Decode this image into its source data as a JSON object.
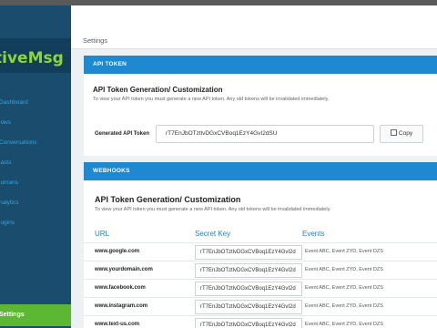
{
  "app": {
    "logo_text": "tiveMsg",
    "colors": {
      "sidebar": "#1a4c6e",
      "accent": "#1e88d0",
      "active": "#5cb832",
      "logo": "#8cd63a"
    }
  },
  "header": {
    "title": "Settings"
  },
  "sidebar": {
    "items": [
      {
        "label": "Dashboard"
      },
      {
        "label": "lows"
      },
      {
        "label": "Conversations"
      },
      {
        "label": "lasts"
      },
      {
        "label": "lumans"
      },
      {
        "label": "nalytics"
      },
      {
        "label": "lugins"
      }
    ],
    "active": {
      "label": "Settings"
    }
  },
  "api_token": {
    "section_title": "API TOKEN",
    "title": "API Token Generation/ Customization",
    "description": "To view your API token you must generate a new API token. Any old tokens will be invalidated immediately.",
    "field_label": "Generated API Token",
    "token_value": "rT7EnJbOTztlvDGxCVBoq1EzY4GvI2dSU",
    "copy_label": "Copy"
  },
  "webhooks": {
    "section_title": "WEBHOOKS",
    "title": "API Token Generation/ Customization",
    "description": "To view your API token you must generate a new API token. Any old tokens will be invalidated immediately.",
    "columns": [
      "URL",
      "Secret Key",
      "Events"
    ],
    "rows": [
      {
        "url": "www.google.com",
        "secret": "rT7EnJbOTztlvDGxCVBoq1EzY4GvI2d",
        "events": "Event ABC, Event ZYD, Event DZS"
      },
      {
        "url": "www.yourdomain.com",
        "secret": "rT7EnJbOTztlvDGxCVBoq1EzY4GvI2d",
        "events": "Event ABC, Event ZYD, Event DZS"
      },
      {
        "url": "www.facebook.com",
        "secret": "rT7EnJbOTztlvDGxCVBoq1EzY4GvI2d",
        "events": "Event ABC, Event ZYD, Event DZS"
      },
      {
        "url": "www.instagram.com",
        "secret": "rT7EnJbOTztlvDGxCVBoq1EzY4GvI2d",
        "events": "Event ABC, Event ZYD, Event DZS"
      },
      {
        "url": "www.text-us.com",
        "secret": "rT7EnJbOTztlvDGxCVBoq1EzY4GvI2d",
        "events": "Event ABC, Event ZYD, Event DZS"
      }
    ]
  }
}
